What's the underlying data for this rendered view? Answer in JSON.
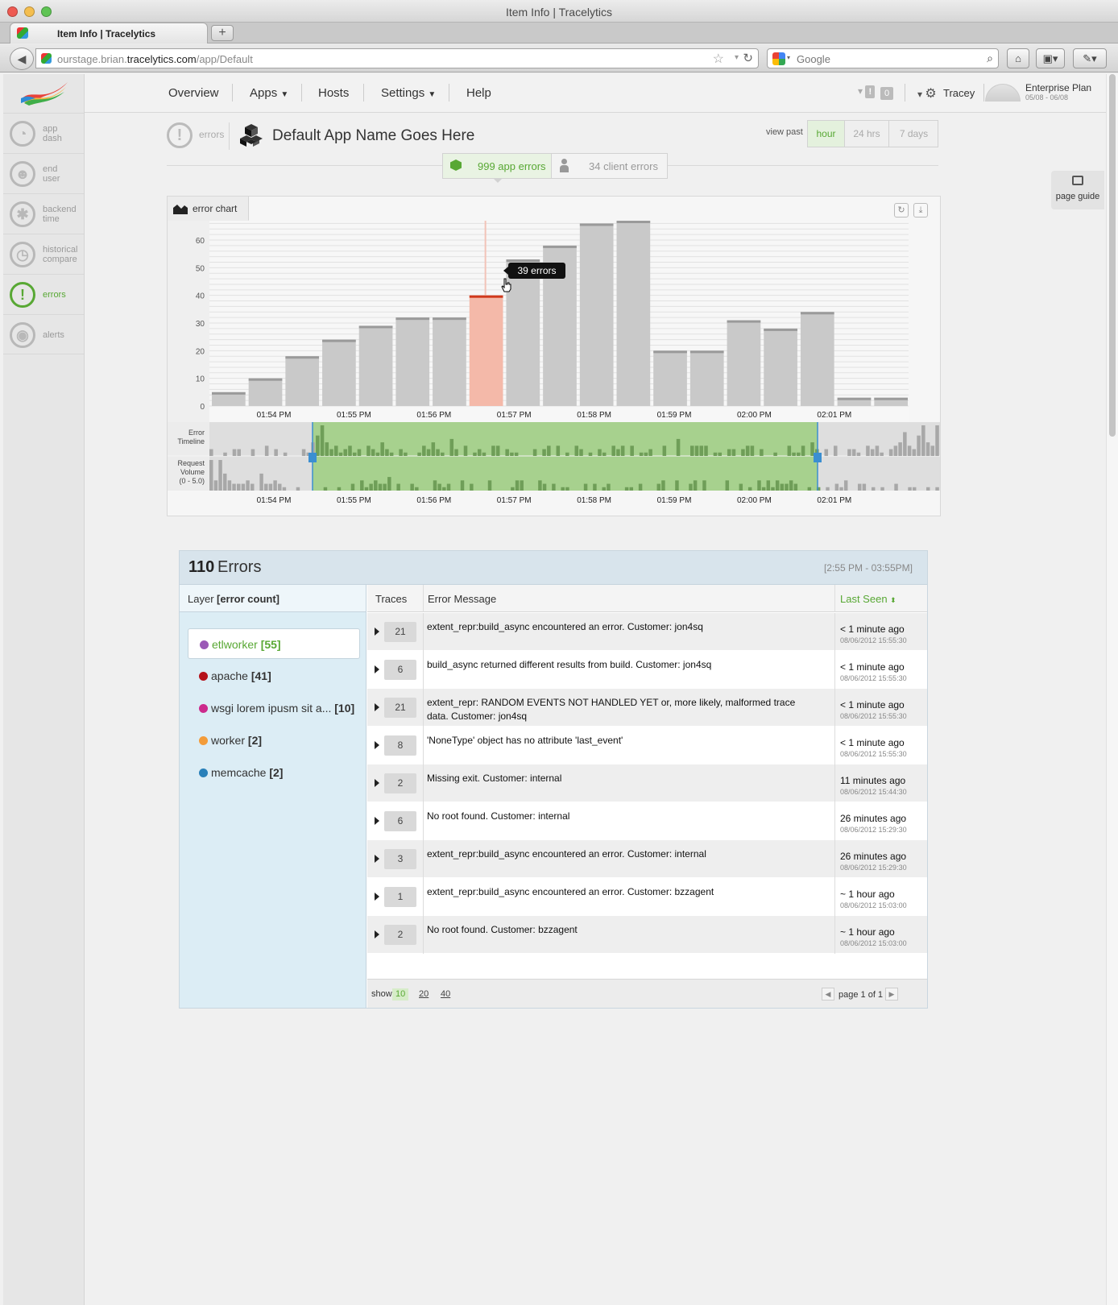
{
  "window": {
    "title": "Item Info | Tracelytics",
    "tab_title": "Item Info | Tracelytics",
    "new_tab_label": "+"
  },
  "browser": {
    "url_prefix": "ourstage.brian.",
    "url_domain": "tracelytics.com",
    "url_path": "/app/Default",
    "search_placeholder": "Google"
  },
  "sidebar": {
    "items": [
      {
        "label": "app dash",
        "icon": "gauge-icon"
      },
      {
        "label": "end user",
        "icon": "user-clock-icon"
      },
      {
        "label": "backend time",
        "icon": "gears-icon"
      },
      {
        "label": "historical compare",
        "icon": "clock-icon"
      },
      {
        "label": "errors",
        "icon": "exclamation-icon",
        "active": true
      },
      {
        "label": "alerts",
        "icon": "broadcast-icon"
      }
    ]
  },
  "topnav": {
    "items": [
      "Overview",
      "Apps",
      "Hosts",
      "Settings",
      "Help"
    ],
    "alerts_count": "0",
    "user": "Tracey",
    "plan": "Enterprise Plan",
    "plan_dates": "05/08 - 06/08"
  },
  "header": {
    "crumb": "errors",
    "app_name": "Default App Name Goes Here",
    "view_past_label": "view past",
    "ranges": [
      "hour",
      "24 hrs",
      "7 days"
    ],
    "active_range": "hour",
    "app_errors_tab": "999 app errors",
    "client_errors_tab": "34 client errors"
  },
  "page_guide_label": "page guide",
  "chart_panel": {
    "tab_label": "error chart",
    "tooltip": "39 errors",
    "timeline_label_1": "Error",
    "timeline_label_2": "Timeline",
    "volume_label_1": "Request",
    "volume_label_2": "Volume",
    "volume_label_3": "(0 - 5.0)"
  },
  "chart_data": {
    "type": "bar",
    "title": "",
    "xlabel": "",
    "ylabel": "",
    "ylim": [
      0,
      67
    ],
    "yticks": [
      0,
      10,
      20,
      30,
      40,
      50,
      60
    ],
    "xtick_labels": [
      "01:54 PM",
      "01:55 PM",
      "01:56 PM",
      "01:57 PM",
      "01:58 PM",
      "01:59 PM",
      "02:00 PM",
      "02:01 PM"
    ],
    "values": [
      5,
      10,
      18,
      24,
      29,
      32,
      32,
      40,
      53,
      58,
      66,
      67,
      20,
      20,
      31,
      28,
      34,
      3,
      3
    ],
    "highlight_index": 7,
    "highlight_color": "#f4b9a9",
    "highlight_cap_color": "#d0391c",
    "bar_color": "#c9c9c9",
    "bar_cap_color": "#9a9a9a",
    "grid": true,
    "selection_color": "#a7d18e",
    "error_timeline": [
      2,
      0,
      0,
      1,
      0,
      2,
      2,
      0,
      0,
      2,
      0,
      0,
      3,
      0,
      2,
      0,
      1,
      0,
      0,
      0,
      2,
      1,
      4,
      6,
      9,
      4,
      2,
      3,
      1,
      2,
      3,
      1,
      2,
      0,
      3,
      2,
      1,
      4,
      2,
      1,
      0,
      2,
      1,
      0,
      0,
      1,
      3,
      2,
      4,
      2,
      1,
      0,
      5,
      2,
      0,
      3,
      0,
      1,
      2,
      1,
      0,
      3,
      3,
      0,
      2,
      1,
      1,
      0,
      0,
      0,
      2,
      0,
      2,
      3,
      0,
      3,
      0,
      1,
      0,
      3,
      2,
      0,
      1,
      0,
      2,
      1,
      0,
      3,
      2,
      3,
      0,
      3,
      0,
      1,
      1,
      2,
      0,
      0,
      3,
      0,
      0,
      5,
      0,
      0,
      3,
      3,
      3,
      3,
      0,
      1,
      1,
      0,
      2,
      2,
      0,
      2,
      3,
      3,
      0,
      2,
      0,
      0,
      1,
      0,
      0,
      3,
      1,
      1,
      3,
      0,
      4,
      2,
      0,
      2,
      0,
      3,
      0,
      0,
      2,
      2,
      1,
      0,
      3,
      2,
      3,
      1,
      0,
      2,
      3,
      4,
      7,
      3,
      2,
      6,
      9,
      4,
      3,
      9
    ],
    "request_volume": [
      9,
      3,
      9,
      5,
      3,
      2,
      2,
      2,
      3,
      2,
      0,
      5,
      2,
      2,
      3,
      2,
      1,
      0,
      0,
      1,
      0,
      0,
      0,
      0,
      0,
      1,
      0,
      0,
      1,
      0,
      0,
      2,
      0,
      3,
      1,
      2,
      3,
      2,
      2,
      4,
      0,
      2,
      0,
      0,
      2,
      1,
      0,
      0,
      0,
      3,
      2,
      1,
      2,
      0,
      0,
      3,
      0,
      2,
      0,
      0,
      0,
      3,
      0,
      0,
      0,
      0,
      1,
      3,
      3,
      0,
      0,
      0,
      3,
      2,
      0,
      2,
      0,
      1,
      1,
      0,
      0,
      0,
      2,
      0,
      2,
      0,
      1,
      2,
      0,
      0,
      0,
      1,
      1,
      0,
      2,
      0,
      0,
      0,
      2,
      3,
      0,
      0,
      3,
      0,
      0,
      2,
      3,
      0,
      3,
      0,
      0,
      0,
      0,
      3,
      0,
      0,
      2,
      0,
      1,
      0,
      3,
      1,
      3,
      1,
      3,
      2,
      2,
      3,
      2,
      0,
      0,
      1,
      0,
      1,
      0,
      1,
      0,
      2,
      1,
      3,
      0,
      0,
      2,
      2,
      0,
      1,
      0,
      1,
      0,
      0,
      2,
      0,
      0,
      1,
      1,
      0,
      0,
      1,
      0,
      1
    ]
  },
  "errors_panel": {
    "count": "110",
    "word": "Errors",
    "range": "[2:55 PM - 03:55PM]",
    "layer_head_1": "Layer",
    "layer_head_2": "[error count]",
    "layers": [
      {
        "name": "etlworker",
        "count": "[55]",
        "color": "#9b59b6",
        "selected": true
      },
      {
        "name": "apache",
        "count": "[41]",
        "color": "#b5121b"
      },
      {
        "name": "wsgi lorem ipusm sit a...",
        "count": "[10]",
        "color": "#cc2a8c"
      },
      {
        "name": "worker",
        "count": "[2]",
        "color": "#f39c3a"
      },
      {
        "name": "memcache",
        "count": "[2]",
        "color": "#2980b9"
      }
    ],
    "columns": {
      "traces": "Traces",
      "message": "Error Message",
      "last_seen": "Last Seen"
    },
    "rows": [
      {
        "traces": "21",
        "message": "extent_repr:build_async encountered an error. Customer: jon4sq",
        "ago": "< 1 minute ago",
        "ts": "08/06/2012 15:55:30"
      },
      {
        "traces": "6",
        "message": "build_async returned different results from build. Customer: jon4sq",
        "ago": "< 1 minute ago",
        "ts": "08/06/2012 15:55:30"
      },
      {
        "traces": "21",
        "message": "extent_repr: RANDOM EVENTS NOT HANDLED YET or, more likely, malformed trace data. Customer: jon4sq",
        "ago": "< 1 minute ago",
        "ts": "08/06/2012 15:55:30"
      },
      {
        "traces": "8",
        "message": "'NoneType' object has no attribute 'last_event'",
        "ago": "< 1 minute ago",
        "ts": "08/06/2012 15:55:30"
      },
      {
        "traces": "2",
        "message": "Missing exit. Customer: internal",
        "ago": "11 minutes ago",
        "ts": "08/06/2012 15:44:30"
      },
      {
        "traces": "6",
        "message": "No root found. Customer: internal",
        "ago": "26 minutes ago",
        "ts": "08/06/2012 15:29:30"
      },
      {
        "traces": "3",
        "message": "extent_repr:build_async encountered an error. Customer: internal",
        "ago": "26 minutes ago",
        "ts": "08/06/2012 15:29:30"
      },
      {
        "traces": "1",
        "message": "extent_repr:build_async encountered an error. Customer: bzzagent",
        "ago": "~ 1 hour ago",
        "ts": "08/06/2012 15:03:00"
      },
      {
        "traces": "2",
        "message": "No root found. Customer: bzzagent",
        "ago": "~ 1 hour ago",
        "ts": "08/06/2012 15:03:00"
      }
    ],
    "show_label": "show",
    "page_sizes": [
      "10",
      "20",
      "40"
    ],
    "active_page_size": "10",
    "pager": "page 1 of 1"
  }
}
